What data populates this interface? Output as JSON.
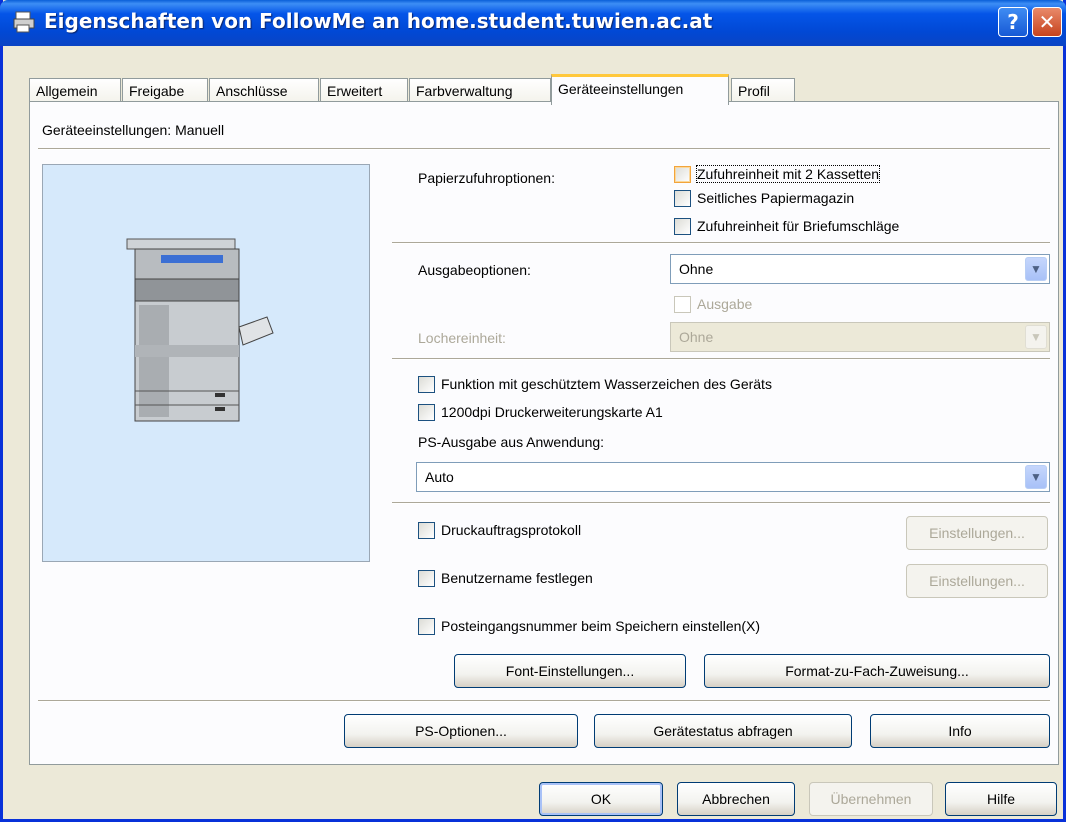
{
  "window": {
    "title": "Eigenschaften von FollowMe an home.student.tuwien.ac.at",
    "help_glyph": "?",
    "close_glyph": "✕"
  },
  "tabs": [
    "Allgemein",
    "Freigabe",
    "Anschlüsse",
    "Erweitert",
    "Farbverwaltung",
    "Geräteeinstellungen",
    "Profil"
  ],
  "active_tab": "Geräteeinstellungen",
  "panel": {
    "mode_label": "Geräteeinstellungen: Manuell",
    "paper_feed": {
      "label": "Papierzufuhroptionen:",
      "options": [
        "Zufuhreinheit mit 2 Kassetten",
        "Seitliches Papiermagazin",
        "Zufuhreinheit für Briefumschläge"
      ]
    },
    "output": {
      "label": "Ausgabeoptionen:",
      "value": "Ohne",
      "sub_checkbox": "Ausgabe"
    },
    "puncher": {
      "label": "Lochereinheit:",
      "value": "Ohne"
    },
    "features": {
      "watermark": "Funktion mit geschütztem Wasserzeichen des Geräts",
      "card": "1200dpi Druckerweiterungskarte A1",
      "ps_label": "PS-Ausgabe aus Anwendung:",
      "ps_value": "Auto"
    },
    "job_log": {
      "label": "Druckauftragsprotokoll",
      "button": "Einstellungen..."
    },
    "username": {
      "label": "Benutzername festlegen",
      "button": "Einstellungen..."
    },
    "inbox": {
      "label": "Posteingangsnummer beim Speichern einstellen(X)"
    },
    "buttons": {
      "font": "Font-Einstellungen...",
      "format": "Format-zu-Fach-Zuweisung...",
      "ps_options": "PS-Optionen...",
      "status": "Gerätestatus abfragen",
      "info": "Info"
    }
  },
  "footer": {
    "ok": "OK",
    "cancel": "Abbrechen",
    "apply": "Übernehmen",
    "help": "Hilfe"
  },
  "colors": {
    "titlebar": "#0455e8",
    "face": "#ece9d8",
    "panel": "#fcfcfe",
    "preview_bg": "#d6e9fb",
    "tab_accent": "#ffc83c"
  },
  "icons": {
    "dropdown": "▼"
  }
}
